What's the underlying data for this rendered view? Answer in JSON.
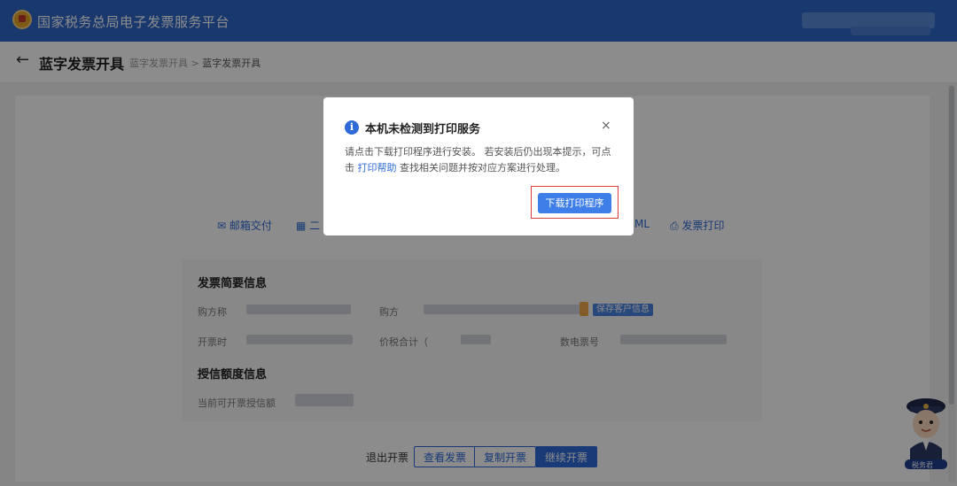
{
  "header": {
    "title": "国家税务总局电子发票服务平台"
  },
  "page": {
    "title": "蓝字发票开具",
    "breadcrumb": [
      "蓝字发票开具",
      "蓝字发票开具"
    ],
    "breadcrumb_sep": ">",
    "back_icon": "arrow-left-icon"
  },
  "actions": {
    "email": "邮箱交付",
    "qr_partial": "二",
    "xml_partial": "ML",
    "print": "发票打印"
  },
  "summary": {
    "section_title": "发票简要信息",
    "buyer_label_1": "购方称",
    "buyer_label_2": "购方",
    "save_customer": "保存客户信息",
    "issue_time": "开票时",
    "total_label": "价税合计（",
    "invoice_no": "数电票号",
    "credit_title": "授信额度信息",
    "credit_label": "当前可开票授信额"
  },
  "buttons": {
    "exit": "退出开票",
    "view": "查看发票",
    "copy": "复制开票",
    "continue": "继续开票"
  },
  "modal": {
    "title": "本机未检测到打印服务",
    "close": "×",
    "message_1": "请点击下载打印程序进行安装。 若安装后仍出现本提示，可点击 ",
    "link": "打印帮助",
    "message_2": " 查找相关问题并按对应方案进行处理。",
    "download_button": "下载打印程序",
    "icon": "info-icon"
  },
  "mascot": {
    "label": "税务君"
  },
  "colors": {
    "primary": "#2f6bd8",
    "header": "#2c66c9",
    "highlight": "#e23b3b"
  }
}
